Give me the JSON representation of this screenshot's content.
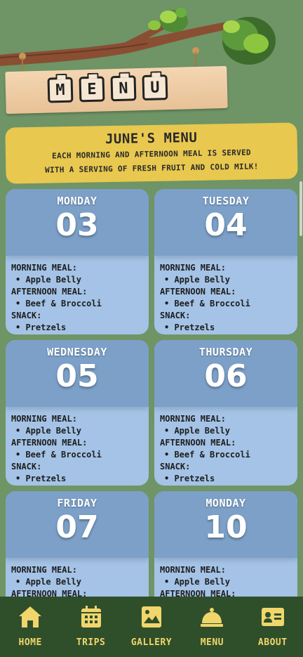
{
  "header": {
    "sign_letters": [
      "M",
      "E",
      "N",
      "U"
    ]
  },
  "banner": {
    "title": "JUNE'S MENU",
    "line1": "EACH MORNING AND AFTERNOON MEAL IS SERVED",
    "line2": "WITH A SERVING OF FRESH FRUIT AND COLD MILK!"
  },
  "days": [
    {
      "day": "MONDAY",
      "date": "03",
      "morning_label": "MORNING MEAL:",
      "morning": "Apple Belly",
      "afternoon_label": "AFTERNOON MEAL:",
      "afternoon": "Beef & Broccoli",
      "snack_label": "SNACK:",
      "snack": "Pretzels"
    },
    {
      "day": "TUESDAY",
      "date": "04",
      "morning_label": "MORNING MEAL:",
      "morning": "Apple Belly",
      "afternoon_label": "AFTERNOON MEAL:",
      "afternoon": "Beef & Broccoli",
      "snack_label": "SNACK:",
      "snack": "Pretzels"
    },
    {
      "day": "WEDNESDAY",
      "date": "05",
      "morning_label": "MORNING MEAL:",
      "morning": "Apple Belly",
      "afternoon_label": "AFTERNOON MEAL:",
      "afternoon": "Beef & Broccoli",
      "snack_label": "SNACK:",
      "snack": "Pretzels"
    },
    {
      "day": "THURSDAY",
      "date": "06",
      "morning_label": "MORNING MEAL:",
      "morning": "Apple Belly",
      "afternoon_label": "AFTERNOON MEAL:",
      "afternoon": "Beef & Broccoli",
      "snack_label": "SNACK:",
      "snack": "Pretzels"
    },
    {
      "day": "FRIDAY",
      "date": "07",
      "morning_label": "MORNING MEAL:",
      "morning": "Apple Belly",
      "afternoon_label": "AFTERNOON MEAL:",
      "afternoon": "",
      "snack_label": "",
      "snack": ""
    },
    {
      "day": "MONDAY",
      "date": "10",
      "morning_label": "MORNING MEAL:",
      "morning": "Apple Belly",
      "afternoon_label": "AFTERNOON MEAL:",
      "afternoon": "",
      "snack_label": "",
      "snack": ""
    }
  ],
  "nav": {
    "home": "HOME",
    "trips": "TRIPS",
    "gallery": "GALLERY",
    "menu": "MENU",
    "about": "ABOUT",
    "icons": [
      "home-icon",
      "calendar-icon",
      "gallery-icon",
      "cloche-icon",
      "id-card-icon"
    ]
  },
  "colors": {
    "background": "#6f9466",
    "banner": "#e8c84f",
    "card": "#a4c3e6",
    "card_header": "#7ca0c8",
    "nav_bg": "#2f4f2b",
    "nav_text": "#f0d66b"
  }
}
